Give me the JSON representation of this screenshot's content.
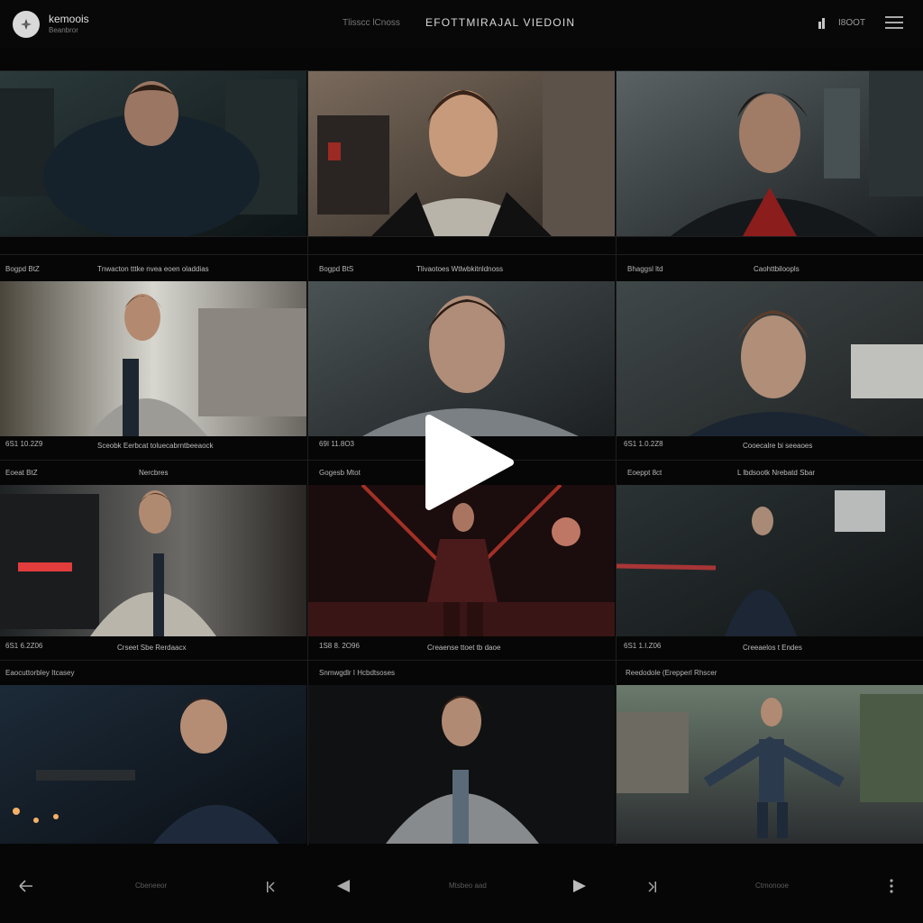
{
  "header": {
    "brand_name": "kemoois",
    "brand_sub": "Beanbror",
    "nav_link": "Tlisscc lCnoss",
    "title": "EFOTTMIRAJAL  VIEDOIN",
    "user_label": "I8OOT"
  },
  "tiles": [
    {
      "id": "t1",
      "top_label": "",
      "top_label_right": "",
      "caption": "",
      "timestamp": ""
    },
    {
      "id": "t2",
      "top_label": "",
      "top_label_right": "",
      "caption": "",
      "timestamp": ""
    },
    {
      "id": "t3",
      "top_label": "",
      "top_label_right": "",
      "caption": "",
      "timestamp": ""
    }
  ],
  "rows": [
    {
      "left": "Bogpd BtZ",
      "mid_left": "Tnwacton tttke nvea eoen oladdias",
      "mid": "Bogpd BtS",
      "mid2": "Tlivaotoes Wtlwbkitnldnoss",
      "right": "Bhaggsl ltd",
      "right2": "Caohttbiloopls"
    },
    {
      "left": "6S1 10.2Z9",
      "mid_left": "Sceobk Eerbcat toluecabrntbeeaock",
      "mid": "69I 11.8O3",
      "mid2": "",
      "right": "6S1 1.0.2Z8",
      "right2": "Cooecalre bi seeaoes"
    },
    {
      "left": "Eoeat BtZ",
      "mid_left": "Nercbres",
      "mid": "Gogesb Mtot",
      "mid2": "",
      "right": "Eoeppt 8ct",
      "right2": "L lbdsootk Nrebatd Sbar"
    },
    {
      "left": "6S1 6.2Z06",
      "mid_left": "Crseet Sbe Rerdaacx",
      "mid": "1S8  8. 2O96",
      "mid2": "Creaense ttoet tb daoe",
      "right": "6S1 1.I.Z06",
      "right2": "Creeaelos t Endes"
    },
    {
      "left": "Eaocuttorbley Itcasey",
      "mid_left": "",
      "mid": "Snmwgdlr I Hcbdtsoses",
      "mid2": "",
      "right": "Reedodole (Erepperl Rhscer",
      "right2": ""
    }
  ],
  "footer": {
    "label_left": "Cbeneeor",
    "label_mid": "Mtsbeo aad",
    "label_right": "Ctmonooe"
  },
  "icons": {
    "logo": "logo-icon",
    "user": "user-icon",
    "menu": "hamburger-menu-icon",
    "play": "play-icon",
    "back": "back-arrow-icon",
    "prev": "skip-previous-icon",
    "rewind": "rewind-icon",
    "forward": "play-forward-icon",
    "next": "skip-next-icon",
    "more": "more-vertical-icon"
  }
}
